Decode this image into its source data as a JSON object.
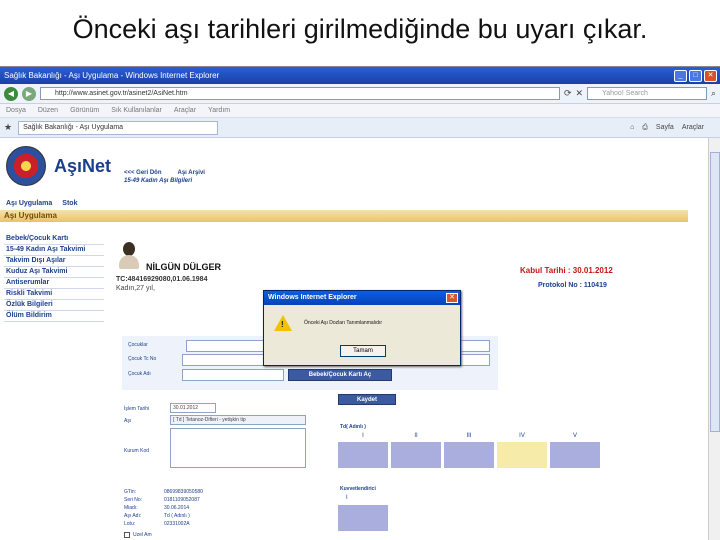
{
  "slide": {
    "title": "Önceki aşı tarihleri girilmediğinde bu uyarı çıkar."
  },
  "browser": {
    "window_title": "Sağlık Bakanlığı - Aşı Uygulama - Windows Internet Explorer",
    "url": "http://www.asinet.gov.tr/asinet2/AsiNet.htm",
    "search_placeholder": "Yahoo! Search",
    "menu": [
      "Dosya",
      "Düzen",
      "Görünüm",
      "Sık Kullanılanlar",
      "Araçlar",
      "Yardım"
    ],
    "tab_label": "Sağlık Bakanlığı - Aşı Uygulama",
    "tools": [
      "Sayfa",
      "Araçlar"
    ]
  },
  "app": {
    "logo": "AşıNet",
    "top_menu": [
      "Aşı Uygulama",
      "Stok"
    ],
    "section": "Aşı Uygulama",
    "left_nav": [
      "Bebek/Çocuk Kartı",
      "15-49 Kadın Aşı Takvimi",
      "Takvim Dışı Aşılar",
      "Kuduz Aşı Takvimi",
      "Antiserumlar",
      "Riskli Takvimi",
      "Özlük Bilgileri",
      "Ölüm Bildirim"
    ]
  },
  "patient": {
    "name": "NİLGÜN DÜLGER",
    "tc": "TC:48416929080,01.06.1984",
    "gender_age": "Kadın,27 yıl,",
    "kabul": "Kabul Tarihi : 30.01.2012",
    "protokol": "Protokol No : 110419"
  },
  "subnav": {
    "back": "<<< Geri Dön",
    "asi_arsivi": "Aşı Arşivi",
    "breadcrumb": "15-49 Kadın Aşı Bilgileri"
  },
  "form": {
    "labels": {
      "cocuklar": "Çocuklar",
      "cocuk_tc": "Çocuk Tc No",
      "cocuk_adi": "Çocuk Adı",
      "islem_tarihi": "İşlem Tarihi",
      "asi": "Aşı",
      "kurum": "Kurum Kod"
    },
    "kart_button": "Bebek/Çocuk Kartı Aç",
    "kaydet_button": "Kaydet",
    "islem_tarihi": "30.01.2012",
    "asi_value": "[ Td ] Tetanoz-Difteri - yetişkin tip"
  },
  "grid": {
    "title": "Td( Adınlı )",
    "headers": [
      "I",
      "II",
      "III",
      "IV",
      "V"
    ],
    "colors": [
      "#a9aedf",
      "#a9aedf",
      "#a9aedf",
      "#f7eba9",
      "#a9aedf"
    ],
    "kuvvet_label": "Kuvvetlendirici",
    "kuvvet_value": "I"
  },
  "info": [
    {
      "k": "GTin:",
      "v": "08699839050580"
    },
    {
      "k": "Seri No:",
      "v": "0181109052087"
    },
    {
      "k": "Miadı:",
      "v": "30.06.2014"
    },
    {
      "k": "Aşı Adı:",
      "v": "Td ( Adınlı )"
    },
    {
      "k": "Lotu:",
      "v": "02331002A"
    }
  ],
  "uzel": "Uzel Am",
  "dialog": {
    "title": "Windows Internet Explorer",
    "message": "Önceki Aşı Dozları Tanımlanmalıdır",
    "ok": "Tamam"
  }
}
